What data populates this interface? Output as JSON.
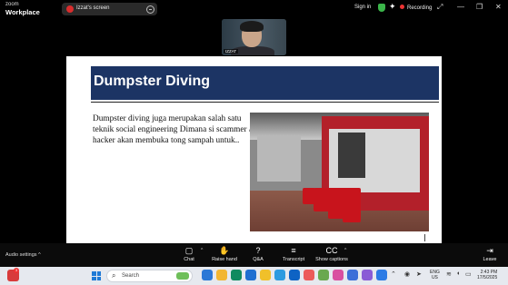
{
  "titlebar": {
    "app_line1": "zoom",
    "app_line2": "Workplace",
    "share_label": "Izzat's screen",
    "sign_in": "Sign in",
    "recording": "Recording",
    "min_glyph": "—",
    "restore_glyph": "❐",
    "close_glyph": "✕",
    "fullscreen_glyph": "⤢"
  },
  "video": {
    "name_tag": "IZZAT"
  },
  "slide": {
    "title": "Dumpster Diving",
    "body": "Dumpster diving juga merupakan salah satu teknik social engineering Dimana si scammer / hacker akan membuka tong sampah untuk.."
  },
  "toolbar": {
    "audio_settings": "Audio settings",
    "caret": "^",
    "items": [
      {
        "label": "Chat",
        "icon": "chat-icon",
        "glyph": "▢"
      },
      {
        "label": "Raise hand",
        "icon": "hand-icon",
        "glyph": "✋"
      },
      {
        "label": "Q&A",
        "icon": "qa-icon",
        "glyph": "?"
      },
      {
        "label": "Transcript",
        "icon": "transcript-icon",
        "glyph": "≡"
      },
      {
        "label": "Show captions",
        "icon": "captions-icon",
        "glyph": "CC"
      }
    ],
    "leave": "Leave",
    "leave_glyph": "⇥"
  },
  "taskbar": {
    "search_placeholder": "Search",
    "weather_badge": "3",
    "lang_line1": "ENG",
    "lang_line2": "US",
    "time": "2:43 PM",
    "date": "17/5/2025",
    "app_colors": [
      "#2b78d6",
      "#f2b632",
      "#0f8a5f",
      "#1f6fd1",
      "#f0c02a",
      "#2d9be0",
      "#0e63c4",
      "#ec5a5a",
      "#6aa84f",
      "#d94fa0",
      "#3d6fd8",
      "#8a5cd6",
      "#2c7be5"
    ]
  },
  "colors": {
    "slide_title_bg": "#1c3464",
    "recording_dot": "#e33",
    "shield": "#3bb54a"
  }
}
